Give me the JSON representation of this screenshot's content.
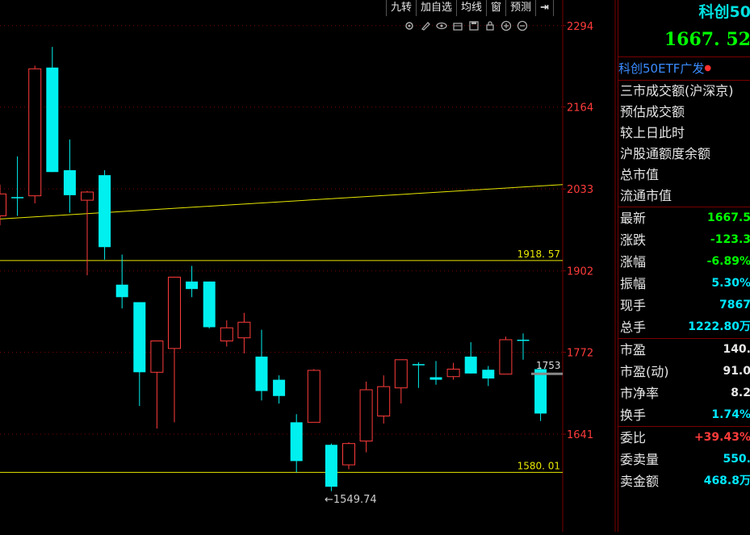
{
  "toolbar": {
    "items": [
      "九转",
      "加自选",
      "均线",
      "窗",
      "预测"
    ],
    "pin_icon": "pin-icon"
  },
  "tool_icons": [
    "settings-icon",
    "draw-icon",
    "eye-icon",
    "chart-icon",
    "save-icon",
    "lock-icon",
    "zoom-in-icon",
    "zoom-out-icon"
  ],
  "colors": {
    "up": "#ff3b3b",
    "down": "#00f0f0",
    "ma": "#e8e800",
    "axis_label": "#ff3b3b",
    "grid": "#7a0000"
  },
  "chart_data": {
    "type": "candlestick",
    "y_ticks": [
      2294,
      2164,
      2033,
      1902,
      1772,
      1641
    ],
    "ylim": [
      1485,
      2335
    ],
    "candles": [
      {
        "o": 1990,
        "c": 2025,
        "h": 2040,
        "l": 1975
      },
      {
        "o": 2020,
        "c": 2020,
        "h": 2085,
        "l": 1990
      },
      {
        "o": 2022,
        "c": 2225,
        "h": 2230,
        "l": 2010
      },
      {
        "o": 2227,
        "c": 2060,
        "h": 2260,
        "l": 2060
      },
      {
        "o": 2063,
        "c": 2023,
        "h": 2112,
        "l": 1995
      },
      {
        "o": 2015,
        "c": 2028,
        "h": 2030,
        "l": 1895
      },
      {
        "o": 2055,
        "c": 1940,
        "h": 2063,
        "l": 1920
      },
      {
        "o": 1880,
        "c": 1860,
        "h": 1928,
        "l": 1842
      },
      {
        "o": 1852,
        "c": 1740,
        "h": 1852,
        "l": 1686
      },
      {
        "o": 1740,
        "c": 1790,
        "h": 1790,
        "l": 1650
      },
      {
        "o": 1778,
        "c": 1892,
        "h": 1892,
        "l": 1660
      },
      {
        "o": 1885,
        "c": 1873,
        "h": 1910,
        "l": 1860
      },
      {
        "o": 1885,
        "c": 1812,
        "h": 1885,
        "l": 1810
      },
      {
        "o": 1790,
        "c": 1811,
        "h": 1823,
        "l": 1781
      },
      {
        "o": 1795,
        "c": 1820,
        "h": 1835,
        "l": 1770
      },
      {
        "o": 1765,
        "c": 1710,
        "h": 1808,
        "l": 1695
      },
      {
        "o": 1728,
        "c": 1702,
        "h": 1735,
        "l": 1690
      },
      {
        "o": 1660,
        "c": 1598,
        "h": 1673,
        "l": 1580
      },
      {
        "o": 1660,
        "c": 1743,
        "h": 1745,
        "l": 1660
      },
      {
        "o": 1624,
        "c": 1557,
        "h": 1626,
        "l": 1550
      },
      {
        "o": 1592,
        "c": 1626,
        "h": 1628,
        "l": 1585
      },
      {
        "o": 1630,
        "c": 1712,
        "h": 1725,
        "l": 1612
      },
      {
        "o": 1670,
        "c": 1717,
        "h": 1735,
        "l": 1658
      },
      {
        "o": 1715,
        "c": 1760,
        "h": 1760,
        "l": 1690
      },
      {
        "o": 1753,
        "c": 1752,
        "h": 1756,
        "l": 1715
      },
      {
        "o": 1732,
        "c": 1728,
        "h": 1758,
        "l": 1720
      },
      {
        "o": 1733,
        "c": 1745,
        "h": 1755,
        "l": 1728
      },
      {
        "o": 1765,
        "c": 1738,
        "h": 1788,
        "l": 1738
      },
      {
        "o": 1744,
        "c": 1730,
        "h": 1750,
        "l": 1718
      },
      {
        "o": 1737,
        "c": 1792,
        "h": 1797,
        "l": 1737
      },
      {
        "o": 1792,
        "c": 1792,
        "h": 1802,
        "l": 1760
      },
      {
        "o": 1745,
        "c": 1674,
        "h": 1748,
        "l": 1662
      }
    ],
    "hlines": [
      {
        "value": 1918.57,
        "label": "1918. 57"
      },
      {
        "value": 1580.01,
        "label": "1580. 01"
      }
    ],
    "trend_line": {
      "from": 1985,
      "to": 2040
    },
    "low_marker": {
      "value": 1549.74,
      "label": "←1549.74"
    },
    "last_marker": {
      "value": 1753,
      "label": "1753"
    }
  },
  "panel": {
    "title": "科创50",
    "price": "1667. 52",
    "subtitle": "科创50ETF广发",
    "info_lines": [
      "三市成交额(沪深京)",
      "预估成交额",
      "较上日此时",
      "沪股通额度余额",
      "总市值",
      "流通市值"
    ],
    "stats1": [
      {
        "label": "最新",
        "value": "1667.5",
        "color": "#00ff00"
      },
      {
        "label": "涨跌",
        "value": "-123.3",
        "color": "#00ff00"
      },
      {
        "label": "涨幅",
        "value": "-6.89%",
        "color": "#00ff00"
      },
      {
        "label": "振幅",
        "value": "5.30%",
        "color": "#00e8ff"
      },
      {
        "label": "现手",
        "value": "7867",
        "color": "#00e8ff"
      },
      {
        "label": "总手",
        "value": "1222.80万",
        "color": "#00e8ff"
      }
    ],
    "stats2": [
      {
        "label": "市盈",
        "value": "140.",
        "color": "#e6e6e6"
      },
      {
        "label": "市盈(动)",
        "value": "91.0",
        "color": "#e6e6e6"
      },
      {
        "label": "市净率",
        "value": "8.2",
        "color": "#e6e6e6"
      },
      {
        "label": "换手",
        "value": "1.74%",
        "color": "#00e8ff"
      }
    ],
    "stats3": [
      {
        "label": "委比",
        "value": "+39.43%",
        "color": "#ff3b3b"
      },
      {
        "label": "委卖量",
        "value": "550.",
        "color": "#00e8ff"
      },
      {
        "label": "卖金额",
        "value": "468.8万",
        "color": "#00e8ff"
      }
    ]
  }
}
